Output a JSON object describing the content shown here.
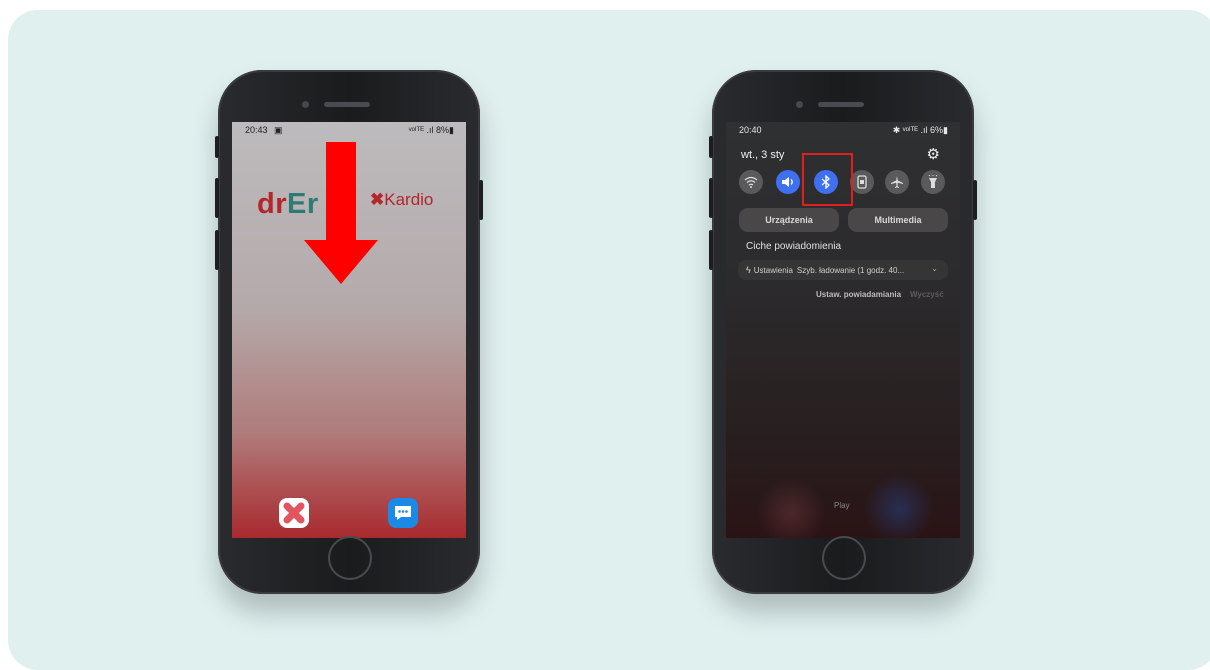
{
  "left_phone": {
    "status_time": "20:43",
    "status_icons": "▣",
    "status_right": "ᵛᵒˡᵀᴱ .ıl 8%▮",
    "logo_dr": "dr",
    "logo_er": "Er",
    "logo_kardio_x": "✖",
    "logo_kardio": "Kardio"
  },
  "right_phone": {
    "status_time": "20:40",
    "status_right": "✱ ᵛᵒˡᵀᴱ .ıl 6%▮",
    "date": "wt., 3 sty",
    "tab_devices": "Urządzenia",
    "tab_media": "Multimedia",
    "section_title": "Ciche powiadomienia",
    "notification": {
      "app": "Ustawienia",
      "text": "Szyb. ładowanie (1 godz. 40..."
    },
    "action_settings": "Ustaw. powiadamiania",
    "action_clear": "Wyczyść",
    "media_label": "Play"
  },
  "colors": {
    "background_card": "#dff0ef",
    "arrow": "#ff0000",
    "brand_red": "#b2262c",
    "brand_teal": "#2d7b74",
    "toggle_on": "#3e70f0",
    "highlight": "#e0201f"
  },
  "icons": [
    "down-arrow-icon",
    "drer-app-icon",
    "messages-app-icon",
    "gear-icon",
    "wifi-icon",
    "sound-icon",
    "bluetooth-icon",
    "portrait-lock-icon",
    "airplane-icon",
    "flashlight-icon"
  ]
}
